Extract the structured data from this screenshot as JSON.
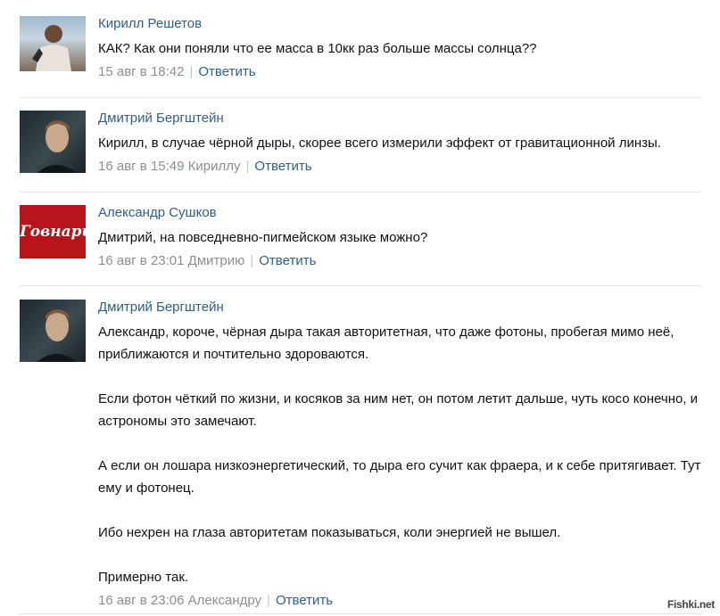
{
  "comments": [
    {
      "author": "Кирилл Решетов",
      "paragraphs": [
        "КАК? Как они поняли что ее масса в 10кк раз больше массы солнца??"
      ],
      "time": "15 авг в 18:42",
      "reply_to": "",
      "reply_label": "Ответить"
    },
    {
      "author": "Дмитрий Бергштейн",
      "paragraphs": [
        "Кирилл, в случае чёрной дыры, скорее всего измерили эффект от гравитационной линзы."
      ],
      "time": "16 авг в 15:49",
      "reply_to": "Кириллу",
      "reply_label": "Ответить"
    },
    {
      "author": "Александр Сушков",
      "paragraphs": [
        "Дмитрий, на повседневно-пигмейском языке можно?"
      ],
      "time": "16 авг в 23:01",
      "reply_to": "Дмитрию",
      "reply_label": "Ответить",
      "avatar_text": "Говнарь"
    },
    {
      "author": "Дмитрий Бергштейн",
      "paragraphs": [
        "Александр, короче, чёрная дыра такая авторитетная, что даже фотоны, пробегая мимо неё, приближаются и почтительно здороваются.",
        "Если фотон чёткий по жизни, и косяков за ним нет, он потом летит дальше, чуть косо конечно, и астрономы это замечают.",
        "А если он лошара низкоэнергетический, то дыра его сучит как фраера, и к себе притягивает. Тут ему и фотонец.",
        "Ибо нехрен на глаза авторитетам показываться, коли энергией не вышел.",
        "Примерно так."
      ],
      "time": "16 авг в 23:06",
      "reply_to": "Александру",
      "reply_label": "Ответить"
    }
  ],
  "watermark": "Fishki.net",
  "colors": {
    "author": "#2f5f8c",
    "meta": "#8a8f95",
    "separator": "#e2e6ea"
  }
}
